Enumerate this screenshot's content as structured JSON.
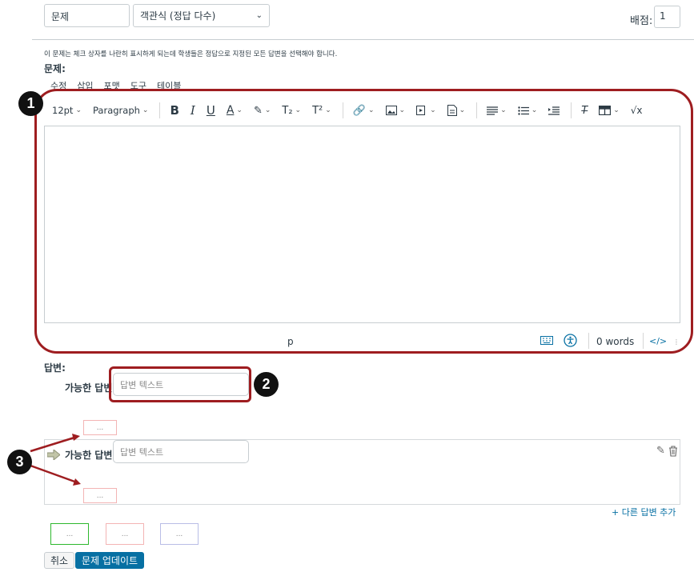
{
  "header": {
    "title_value": "문제",
    "type_select": "객관식 (정답 다수)",
    "points_label": "배점:",
    "points_value": "1"
  },
  "instructions": "이 문제는 체크 상자를 나란히 표시하게 되는데 학생들은 정답으로 지정된 모든 답변을 선택해야 합니다.",
  "question_label": "문제:",
  "menubar": [
    "수정",
    "삽입",
    "포맷",
    "도구",
    "테이블"
  ],
  "toolbar": {
    "font_size": "12pt",
    "block_format": "Paragraph",
    "bold": "B",
    "italic": "I",
    "underline": "U",
    "text_color": "A",
    "subscript": "T₂",
    "superscript": "T²",
    "math": "√x"
  },
  "statusbar": {
    "path": "p",
    "word_count": "0 words",
    "html_toggle": "</>"
  },
  "answers": {
    "label": "답변:",
    "possible_answer_label": "가능한 답변",
    "placeholder": "답변 텍스트",
    "dots": "...",
    "add_answer": "+ 다른 답변 추가"
  },
  "buttons": {
    "cancel": "취소",
    "update": "문제 업데이트"
  },
  "callouts": [
    "1",
    "2",
    "3"
  ],
  "colors": {
    "callout_border": "#9e1d20",
    "primary_button": "#0770a3",
    "link": "#0770a3"
  }
}
